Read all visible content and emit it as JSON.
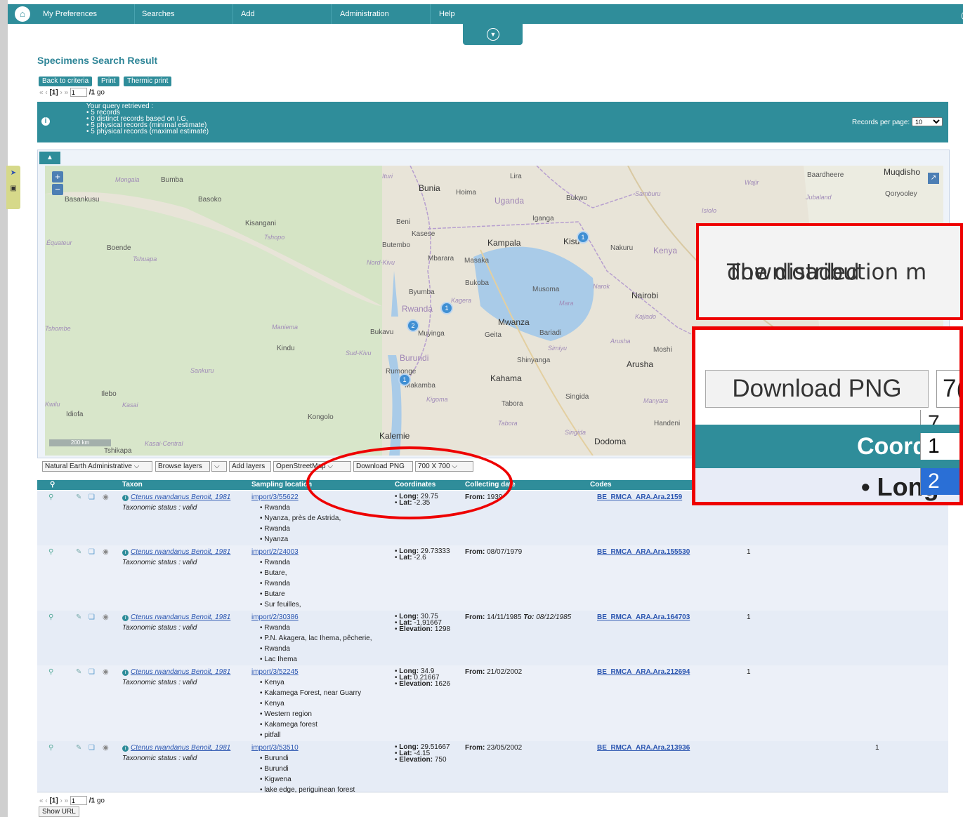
{
  "nav": {
    "items": [
      "My Preferences",
      "Searches",
      "Add",
      "Administration",
      "Help"
    ]
  },
  "page": {
    "title": "Specimens Search Result",
    "buttons": [
      "Back to criteria",
      "Print",
      "Thermic print"
    ],
    "pager": {
      "prev": "« ‹",
      "current": "[1]",
      "next": "› »",
      "page_value": "1",
      "total": "/1",
      "go": "go"
    }
  },
  "info": {
    "lines": [
      "Your query retrieved :",
      "• 5 records",
      "• 0 distinct records based on I.G.",
      "• 5 physical records (minimal estimate)",
      "• 5 physical records (maximal estimate)"
    ],
    "records_per_page_label": "Records per page:",
    "records_per_page_value": "10"
  },
  "map": {
    "scale": "200 km",
    "labels": {
      "mongala": "Mongala",
      "bumba": "Bumba",
      "basankusu": "Basankusu",
      "basoko": "Basoko",
      "ituri": "Ituri",
      "bunia": "Bunia",
      "hoima": "Hoima",
      "uganda": "Uganda",
      "lira": "Lira",
      "bukwo": "Bukwo",
      "wajir": "Wajir",
      "baardheere": "Baardheere",
      "muqdisho": "Muqdisho",
      "samburu": "Samburu",
      "isiolo": "Isiolo",
      "jubaland": "Jubaland",
      "qoryooley": "Qoryooley",
      "kisangani": "Kisangani",
      "tshopo": "Tshopo",
      "equateur": "Équateur",
      "boende": "Boende",
      "tshuapa": "Tshuapa",
      "beni": "Beni",
      "kasese": "Kasese",
      "butembo": "Butembo",
      "iganga": "Iganga",
      "kampala": "Kampala",
      "kisumu": "Kisu",
      "nakuru": "Nakuru",
      "kenya": "Kenya",
      "nordkivu": "Nord-Kivu",
      "mbarara": "Mbarara",
      "masaka": "Masaka",
      "bukoba": "Bukoba",
      "musoma": "Musoma",
      "narok": "Narok",
      "mara": "Mara",
      "nairobi": "Nairobi",
      "byumba": "Byumba",
      "rwanda": "Rwanda",
      "kagera": "Kagera",
      "kajiado": "Kajiado",
      "maniema": "Maniema",
      "tshombe": "Tshombe",
      "bukavu": "Bukavu",
      "muyinga": "Muyinga",
      "mwanza": "Mwanza",
      "geita": "Geita",
      "bariadi": "Bariadi",
      "arusha_r": "Arusha",
      "moshi": "Moshi",
      "kindu": "Kindu",
      "sudkivu": "Sud-Kivu",
      "burundi": "Burundi",
      "simiyu": "Simiyu",
      "shinyanga": "Shinyanga",
      "arusha": "Arusha",
      "sankuru": "Sankuru",
      "rumonge": "Rumonge",
      "makamba": "Makamba",
      "kahama": "Kahama",
      "ilebo": "Ilebo",
      "kigoma": "Kigoma",
      "tabora_c": "Tabora",
      "singida_c": "Singida",
      "manyara": "Manyara",
      "kwilu": "Kwilu",
      "kasai": "Kasai",
      "idiofa": "Idiofa",
      "kongolo": "Kongolo",
      "tabora_r": "Tabora",
      "handeni": "Handeni",
      "kalemie": "Kalemie",
      "singida_r": "Singida",
      "tshikapa": "Tshikapa",
      "kasaicentral": "Kasai-Central",
      "dodoma": "Dodoma"
    },
    "markers": [
      "1",
      "1",
      "2",
      "1"
    ]
  },
  "controls": {
    "layer_select": "Natural Earth Administrative",
    "browse_layers": "Browse layers",
    "add_layers": "Add layers",
    "basemap_select": "OpenStreetMap",
    "download_png": "Download PNG",
    "size_select": "700 X 700"
  },
  "table": {
    "headers": [
      "Taxon",
      "Sampling location",
      "Coordinates",
      "Collecting date",
      "Codes"
    ],
    "rows": [
      {
        "taxon": "Ctenus rwandanus Benoit, 1981",
        "status": "Taxonomic status : valid",
        "location_link": "import/3/55622",
        "locations": [
          "Rwanda",
          "Nyanza, près de Astrida,",
          "Rwanda",
          "Nyanza"
        ],
        "long": "29.75",
        "lat": "-2.35",
        "elevation": "",
        "date_from": "1939",
        "date_to": "",
        "code": "BE_RMCA_ARA.Ara.2159",
        "count": ""
      },
      {
        "taxon": "Ctenus rwandanus Benoit, 1981",
        "status": "Taxonomic status : valid",
        "location_link": "import/2/24003",
        "locations": [
          "Rwanda",
          "Butare,",
          "Rwanda",
          "Butare",
          "Sur feuilles,"
        ],
        "long": "29.73333",
        "lat": "-2.6",
        "elevation": "",
        "date_from": "08/07/1979",
        "date_to": "",
        "code": "BE_RMCA_ARA.Ara.155530",
        "count": "1"
      },
      {
        "taxon": "Ctenus rwandanus Benoit, 1981",
        "status": "Taxonomic status : valid",
        "location_link": "import/2/30386",
        "locations": [
          "Rwanda",
          "P.N. Akagera, lac Ihema, pêcherie,",
          "Rwanda",
          "Lac Ihema"
        ],
        "long": "30.75",
        "lat": "-1.91667",
        "elevation": "1298",
        "date_from": "14/11/1985",
        "date_to": "08/12/1985",
        "code": "BE_RMCA_ARA.Ara.164703",
        "count": "1"
      },
      {
        "taxon": "Ctenus rwandanus Benoit, 1981",
        "status": "Taxonomic status : valid",
        "location_link": "import/3/52245",
        "locations": [
          "Kenya",
          "Kakamega Forest, near Guarry",
          "Kenya",
          "Western region",
          "Kakamega forest",
          "pitfall"
        ],
        "long": "34.9",
        "lat": "0.21667",
        "elevation": "1626",
        "date_from": "21/02/2002",
        "date_to": "",
        "code": "BE_RMCA_ARA.Ara.212694",
        "count": "1"
      },
      {
        "taxon": "Ctenus rwandanus Benoit, 1981",
        "status": "Taxonomic status : valid",
        "location_link": "import/3/53510",
        "locations": [
          "Burundi",
          "Burundi",
          "Kigwena",
          "lake edge, periguinean forest"
        ],
        "long": "29.51667",
        "lat": "-4.15",
        "elevation": "750",
        "date_from": "23/05/2002",
        "date_to": "",
        "code": "BE_RMCA_ARA.Ara.213936",
        "count": "1"
      }
    ],
    "field_labels": {
      "long": "Long:",
      "lat": "Lat:",
      "elevation": "Elevation:",
      "from": "From:",
      "to": "To:"
    }
  },
  "footer": {
    "show_url": "Show URL"
  },
  "callout": {
    "line1": "The distribution m",
    "line2": "downloaded"
  },
  "zoom_inset": {
    "download_png": "Download PNG",
    "select_value": "7(",
    "options": [
      "7",
      "1",
      "2"
    ],
    "header": "Coord",
    "row_text": "• Long"
  },
  "colors": {
    "accent": "#2f8d9a",
    "annotation": "#ee0000"
  }
}
